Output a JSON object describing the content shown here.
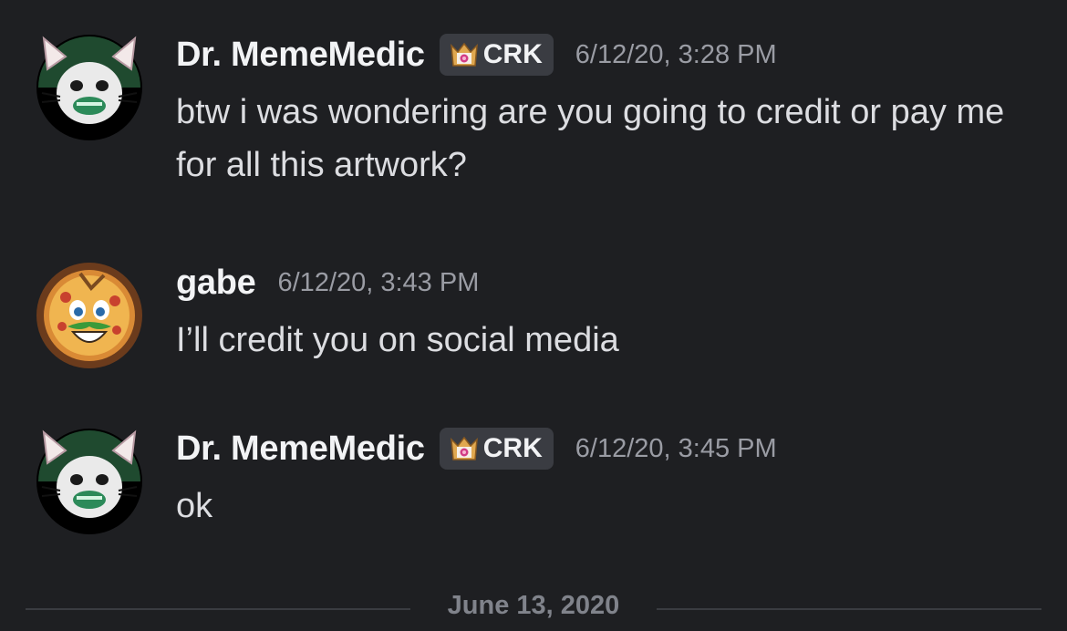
{
  "messages": [
    {
      "username": "Dr. MemeMedic",
      "tag": "CRK",
      "timestamp": "6/12/20, 3:28 PM",
      "text": "btw i was wondering are you going to credit or pay me for all this artwork?",
      "avatar_icon": "cat-avatar-icon",
      "tag_icon": "crown-icon"
    },
    {
      "username": "gabe",
      "timestamp": "6/12/20, 3:43 PM",
      "text": "I’ll credit you on social media",
      "avatar_icon": "pizza-avatar-icon"
    },
    {
      "username": "Dr. MemeMedic",
      "tag": "CRK",
      "timestamp": "6/12/20, 3:45 PM",
      "text": "ok",
      "avatar_icon": "cat-avatar-icon",
      "tag_icon": "crown-icon"
    }
  ],
  "date_divider": "June 13, 2020",
  "colors": {
    "background": "#1e1f22",
    "username": "#f2f3f5",
    "timestamp": "#9a9ca4",
    "tag_background": "#3a3c42",
    "tag_icon": "#e0a850"
  }
}
